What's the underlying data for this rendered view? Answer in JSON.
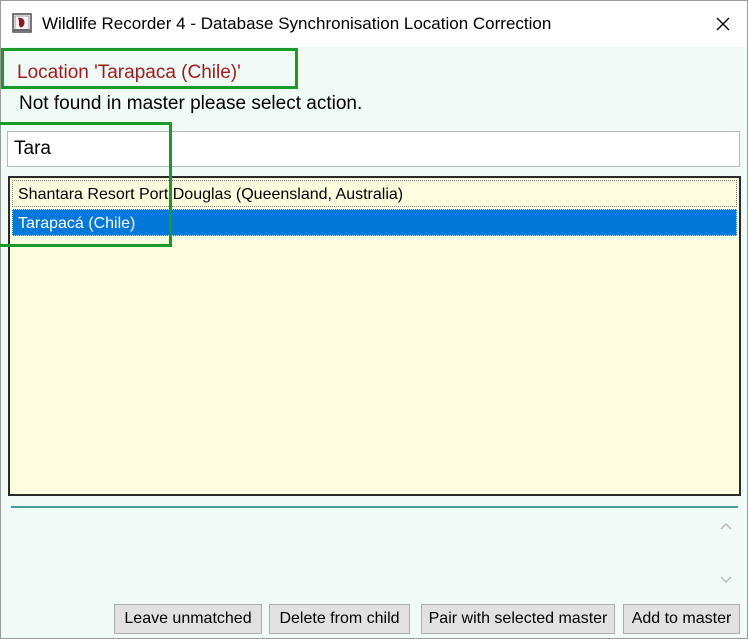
{
  "window": {
    "title": "Wildlife Recorder 4 - Database Synchronisation Location Correction",
    "close_glyph": "✕"
  },
  "main": {
    "location_label": "Location 'Tarapaca (Chile)'",
    "message": "Not found in master please select action.",
    "search_value": "Tara",
    "list_items": [
      {
        "label": "Shantara Resort Port Douglas (Queensland, Australia)",
        "selected": false
      },
      {
        "label": "Tarapacá (Chile)",
        "selected": true
      }
    ]
  },
  "scrollbar": {
    "up_glyph": "⌃",
    "down_glyph": "⌄"
  },
  "buttons": {
    "leave_unmatched": "Leave unmatched",
    "delete_from_child": "Delete from child",
    "pair_with_selected": "Pair with selected master",
    "add_to_master": "Add to master"
  },
  "colors": {
    "background": "#f0fbf8",
    "list_background": "#fffde0",
    "selection": "#0078d7",
    "location_text": "#9b1b1b",
    "annotation_highlight": "#1a9a2a"
  },
  "icons": {
    "app": "wildlife-recorder-icon",
    "close": "close-icon",
    "scroll_up": "chevron-up-icon",
    "scroll_down": "chevron-down-icon"
  }
}
